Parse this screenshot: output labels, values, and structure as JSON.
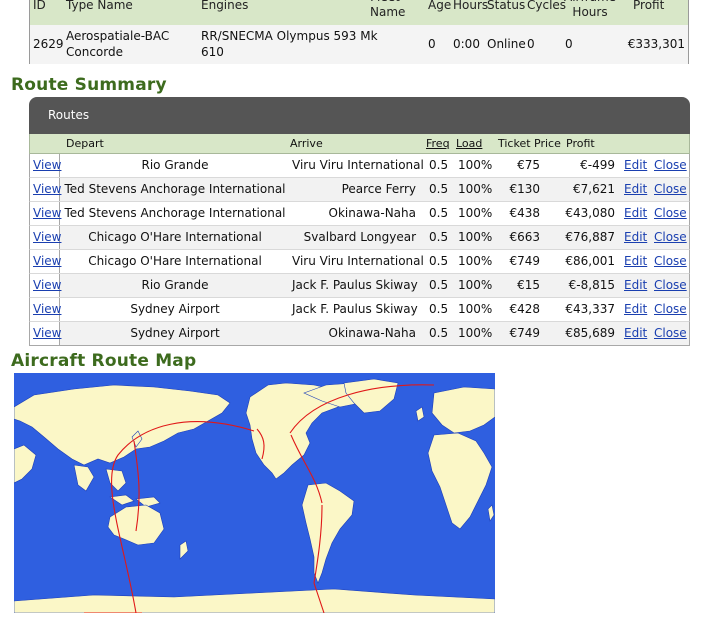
{
  "aircraft": {
    "headers": {
      "id": "ID",
      "type": "Type Name",
      "engines": "Engines",
      "fleet_name": "Fleet Name",
      "age": "Age",
      "hours": "Hours",
      "status": "Status",
      "cycles": "Cycles",
      "airframe_hours": "Airframe Hours",
      "profit": "Profit"
    },
    "row": {
      "id": "2629",
      "type_line1": "Aerospatiale-BAC",
      "type_line2": "Concorde",
      "engines_line1": "RR/SNECMA Olympus 593 Mk",
      "engines_line2": "610",
      "age": "0",
      "hours": "0:00",
      "status": "Online",
      "cycles": "0",
      "airframe_hours": "0",
      "profit": "€333,301"
    }
  },
  "route_summary": {
    "title": "Route Summary",
    "panel_title": "Routes",
    "headers": {
      "depart": "Depart",
      "arrive": "Arrive",
      "freq": "Freq",
      "load": "Load",
      "ticket_price": "Ticket Price",
      "profit": "Profit"
    },
    "view_label": "View",
    "edit_label": "Edit",
    "close_label": "Close",
    "rows": [
      {
        "depart": "Rio Grande",
        "arrive": "Viru Viru International",
        "freq": "0.5",
        "load": "100%",
        "price": "€75",
        "profit": "€-499"
      },
      {
        "depart": "Ted Stevens Anchorage International",
        "arrive": "Pearce Ferry",
        "freq": "0.5",
        "load": "100%",
        "price": "€130",
        "profit": "€7,621"
      },
      {
        "depart": "Ted Stevens Anchorage International",
        "arrive": "Okinawa-Naha",
        "freq": "0.5",
        "load": "100%",
        "price": "€438",
        "profit": "€43,080"
      },
      {
        "depart": "Chicago O'Hare International",
        "arrive": "Svalbard Longyear",
        "freq": "0.5",
        "load": "100%",
        "price": "€663",
        "profit": "€76,887"
      },
      {
        "depart": "Chicago O'Hare International",
        "arrive": "Viru Viru International",
        "freq": "0.5",
        "load": "100%",
        "price": "€749",
        "profit": "€86,001"
      },
      {
        "depart": "Rio Grande",
        "arrive": "Jack F. Paulus Skiway",
        "freq": "0.5",
        "load": "100%",
        "price": "€15",
        "profit": "€-8,815"
      },
      {
        "depart": "Sydney Airport",
        "arrive": "Jack F. Paulus Skiway",
        "freq": "0.5",
        "load": "100%",
        "price": "€428",
        "profit": "€43,337"
      },
      {
        "depart": "Sydney Airport",
        "arrive": "Okinawa-Naha",
        "freq": "0.5",
        "load": "100%",
        "price": "€749",
        "profit": "€85,689"
      }
    ]
  },
  "route_map": {
    "title": "Aircraft Route Map",
    "colors": {
      "ocean": "#2f5fe0",
      "land": "#fbf7c7",
      "route": "#e01818"
    }
  }
}
